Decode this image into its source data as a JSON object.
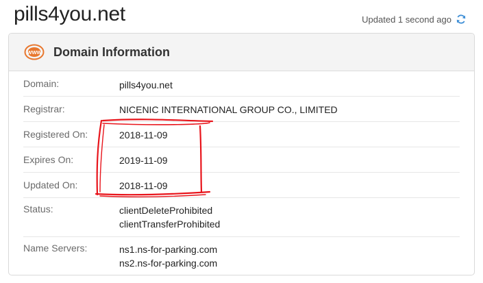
{
  "header": {
    "site_title": "pills4you.net",
    "updated_text": "Updated 1 second ago",
    "refresh_icon": "refresh-icon"
  },
  "panel": {
    "icon": "www-icon",
    "icon_text": "WWW",
    "title": "Domain Information",
    "rows": [
      {
        "label": "Domain:",
        "value": "pills4you.net"
      },
      {
        "label": "Registrar:",
        "value": "NICENIC INTERNATIONAL GROUP CO., LIMITED"
      },
      {
        "label": "Registered On:",
        "value": "2018-11-09"
      },
      {
        "label": "Expires On:",
        "value": "2019-11-09"
      },
      {
        "label": "Updated On:",
        "value": "2018-11-09"
      },
      {
        "label": "Status:",
        "values": [
          "clientDeleteProhibited",
          "clientTransferProhibited"
        ]
      },
      {
        "label": "Name Servers:",
        "values": [
          "ns1.ns-for-parking.com",
          "ns2.ns-for-parking.com"
        ]
      }
    ]
  },
  "colors": {
    "accent_orange": "#e8772e",
    "refresh_blue": "#3f8fd6",
    "annotation_red": "#e8141b"
  }
}
